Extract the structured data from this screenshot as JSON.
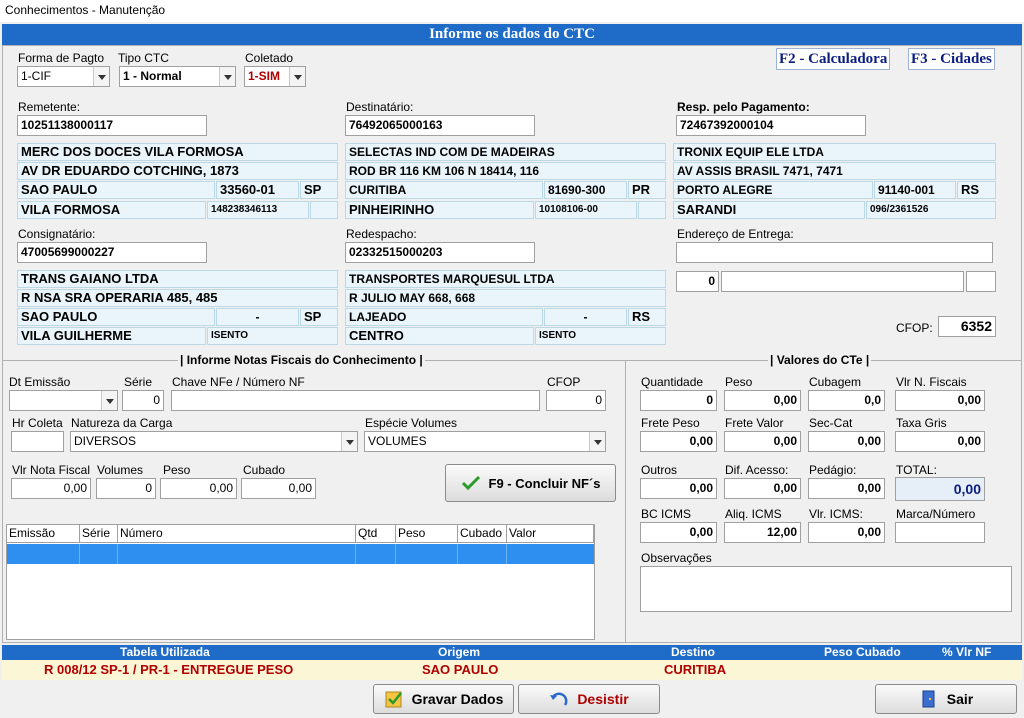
{
  "window": {
    "title": "Conhecimentos - Manutenção"
  },
  "header": {
    "title": "Informe os dados do CTC"
  },
  "shortcuts": {
    "f2": "F2 - Calculadora",
    "f3": "F3 - Cidades"
  },
  "top": {
    "forma_pagto_label": "Forma de Pagto",
    "forma_pagto_value": "1-CIF",
    "tipo_ctc_label": "Tipo CTC",
    "tipo_ctc_value": "1 - Normal",
    "coletado_label": "Coletado",
    "coletado_value": "1-SIM"
  },
  "remetente": {
    "label": "Remetente:",
    "cnpj": "10251138000117",
    "nome": "MERC DOS DOCES VILA FORMOSA",
    "endereco": "AV DR EDUARDO COTCHING, 1873",
    "cidade": "SAO PAULO",
    "cep": "33560-01",
    "uf": "SP",
    "bairro": "VILA FORMOSA",
    "ie": "148238346113"
  },
  "destinatario": {
    "label": "Destinatário:",
    "cnpj": "76492065000163",
    "nome": "SELECTAS IND COM DE MADEIRAS",
    "endereco": "ROD BR 116 KM 106  N 18414, 116",
    "cidade": "CURITIBA",
    "cep": "81690-300",
    "uf": "PR",
    "bairro": "PINHEIRINHO",
    "ie": "10108106-00"
  },
  "resp_pagamento": {
    "label": "Resp. pelo Pagamento:",
    "cnpj": "72467392000104",
    "nome": "TRONIX EQUIP ELE LTDA",
    "endereco": "AV ASSIS BRASIL 7471, 7471",
    "cidade": "PORTO ALEGRE",
    "cep": "91140-001",
    "uf": "RS",
    "bairro": "SARANDI",
    "ie": "096/2361526"
  },
  "consignatario": {
    "label": "Consignatário:",
    "cnpj": "47005699000227",
    "nome": "TRANS GAIANO LTDA",
    "endereco": "R NSA SRA OPERARIA 485, 485",
    "cidade": "SAO PAULO",
    "cep": "-",
    "uf": "SP",
    "bairro": "VILA GUILHERME",
    "ie": "ISENTO"
  },
  "redespacho": {
    "label": "Redespacho:",
    "cnpj": "02332515000203",
    "nome": "TRANSPORTES MARQUESUL LTDA",
    "endereco": "R JULIO MAY 668, 668",
    "cidade": "LAJEADO",
    "cep": "-",
    "uf": "RS",
    "bairro": "CENTRO",
    "ie": "ISENTO"
  },
  "entrega": {
    "label": "Endereço de Entrega:",
    "numero": "0"
  },
  "cfop": {
    "label": "CFOP:",
    "value": "6352"
  },
  "notas": {
    "title": "| Informe  Notas Fiscais do Conhecimento |",
    "dt_emissao_label": "Dt Emissão",
    "serie_label": "Série",
    "serie_value": "0",
    "chave_label": "Chave NFe / Número NF",
    "cfop_label": "CFOP",
    "cfop_value": "0",
    "hr_coleta_label": "Hr Coleta",
    "natureza_label": "Natureza da Carga",
    "natureza_value": "DIVERSOS",
    "especie_label": "Espécie Volumes",
    "especie_value": "VOLUMES",
    "vlr_nota_label": "Vlr Nota Fiscal",
    "vlr_nota_value": "0,00",
    "volumes_label": "Volumes",
    "volumes_value": "0",
    "peso_label": "Peso",
    "peso_value": "0,00",
    "cubado_label": "Cubado",
    "cubado_value": "0,00",
    "concluir_label": "F9 - Concluir NF´s",
    "grid_headers": [
      "Emissão",
      "Série",
      "Número",
      "Qtd",
      "Peso",
      "Cubado",
      "Valor"
    ]
  },
  "valores": {
    "title": "| Valores do CTe |",
    "quantidade_label": "Quantidade",
    "quantidade_value": "0",
    "peso_label": "Peso",
    "peso_value": "0,00",
    "cubagem_label": "Cubagem",
    "cubagem_value": "0,0",
    "vlr_nf_label": "Vlr N. Fiscais",
    "vlr_nf_value": "0,00",
    "frete_peso_label": "Frete Peso",
    "frete_peso_value": "0,00",
    "frete_valor_label": "Frete Valor",
    "frete_valor_value": "0,00",
    "sec_cat_label": "Sec-Cat",
    "sec_cat_value": "0,00",
    "taxa_gris_label": "Taxa Gris",
    "taxa_gris_value": "0,00",
    "outros_label": "Outros",
    "outros_value": "0,00",
    "dif_acesso_label": "Dif. Acesso:",
    "dif_acesso_value": "0,00",
    "pedagio_label": "Pedágio:",
    "pedagio_value": "0,00",
    "total_label": "TOTAL:",
    "total_value": "0,00",
    "bc_icms_label": "BC ICMS",
    "bc_icms_value": "0,00",
    "aliq_icms_label": "Aliq. ICMS",
    "aliq_icms_value": "12,00",
    "vlr_icms_label": "Vlr. ICMS:",
    "vlr_icms_value": "0,00",
    "marca_label": "Marca/Número",
    "observacoes_label": "Observações"
  },
  "tabela": {
    "headers": {
      "tabela": "Tabela Utilizada",
      "origem": "Origem",
      "destino": "Destino",
      "peso_cubado": "Peso Cubado",
      "vlr_nf": "% Vlr NF"
    },
    "row": {
      "tabela": "R 008/12  SP-1 / PR-1 -  ENTREGUE  PESO",
      "origem": "SAO PAULO",
      "destino": "CURITIBA"
    }
  },
  "actions": {
    "gravar": "Gravar Dados",
    "desistir": "Desistir",
    "sair": "Sair"
  },
  "colors": {
    "header_blue": "#1e6bc8",
    "selection_blue": "#2e8ff0",
    "total_bg": "#e6eef8",
    "dark_red": "#b00000"
  }
}
